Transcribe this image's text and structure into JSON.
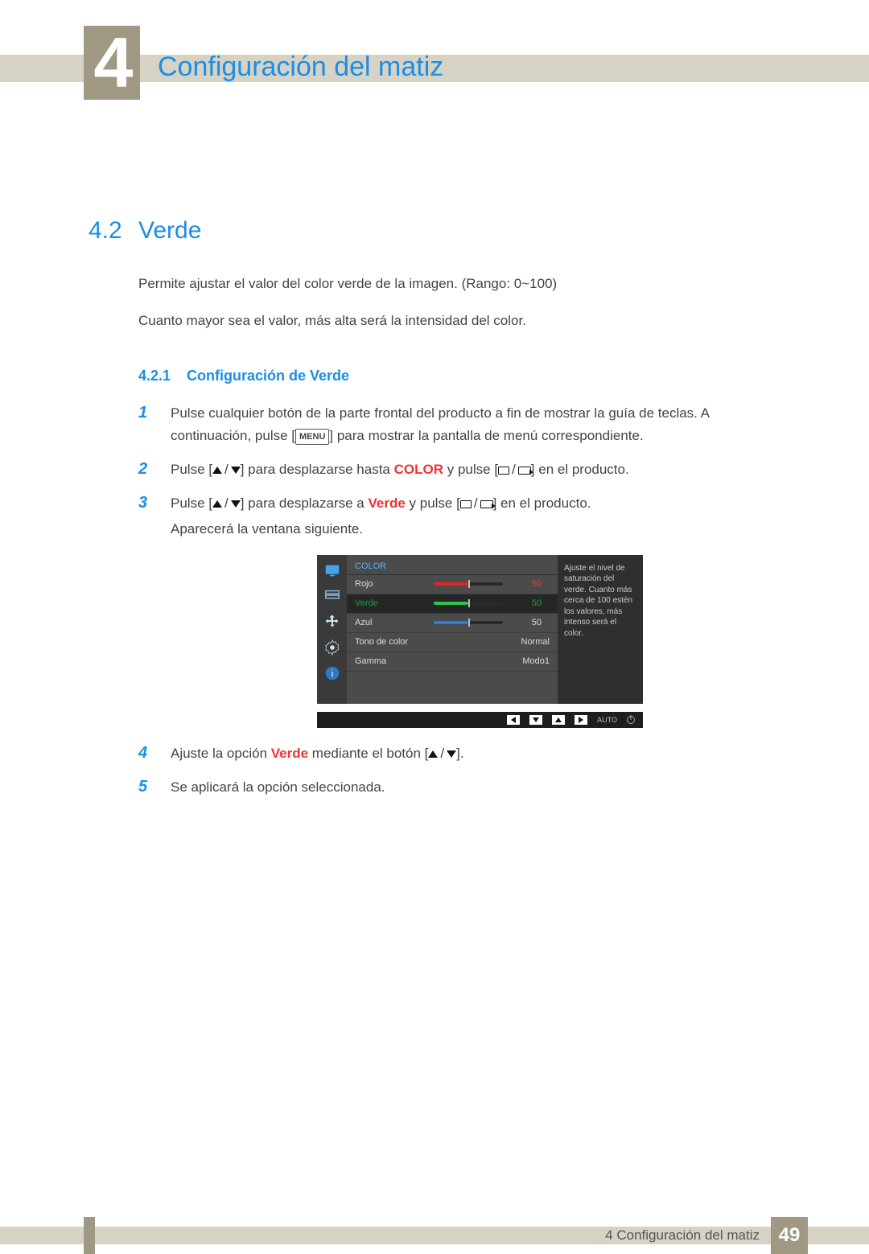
{
  "header": {
    "chapter_num": "4",
    "title": "Configuración del matiz"
  },
  "section": {
    "num": "4.2",
    "title": "Verde",
    "para1": "Permite ajustar el valor del color verde de la imagen. (Rango: 0~100)",
    "para2": "Cuanto mayor sea el valor, más alta será la intensidad del color."
  },
  "subsection": {
    "num": "4.2.1",
    "title": "Configuración de Verde"
  },
  "steps": {
    "s1": {
      "num": "1",
      "t1": "Pulse cualquier botón de la parte frontal del producto a fin de mostrar la guía de teclas. A continuación, pulse [",
      "menu": "MENU",
      "t2": "] para mostrar la pantalla de menú correspondiente."
    },
    "s2": {
      "num": "2",
      "t1": "Pulse [",
      "t2": "] para desplazarse hasta ",
      "kw": "COLOR",
      "t3": " y pulse [",
      "t4": "] en el producto."
    },
    "s3": {
      "num": "3",
      "t1": "Pulse [",
      "t2": "] para desplazarse a ",
      "kw": "Verde",
      "t3": " y pulse [",
      "t4": "] en el producto.",
      "after": "Aparecerá la ventana siguiente."
    },
    "s4": {
      "num": "4",
      "t1": "Ajuste la opción ",
      "kw": "Verde",
      "t2": " mediante el botón [",
      "t3": "]."
    },
    "s5": {
      "num": "5",
      "t1": "Se aplicará la opción seleccionada."
    }
  },
  "osd": {
    "title": "COLOR",
    "rows": {
      "rojo": {
        "label": "Rojo",
        "value": "50"
      },
      "verde": {
        "label": "Verde",
        "value": "50"
      },
      "azul": {
        "label": "Azul",
        "value": "50"
      },
      "tono": {
        "label": "Tono de color",
        "value": "Normal"
      },
      "gamma": {
        "label": "Gamma",
        "value": "Modo1"
      }
    },
    "help": "Ajuste el nivel de saturación del verde. Cuanto más cerca de 100 estén los valores, más intenso será el color.",
    "nav_auto": "AUTO"
  },
  "footer": {
    "text": "4 Configuración del matiz",
    "page": "49"
  }
}
